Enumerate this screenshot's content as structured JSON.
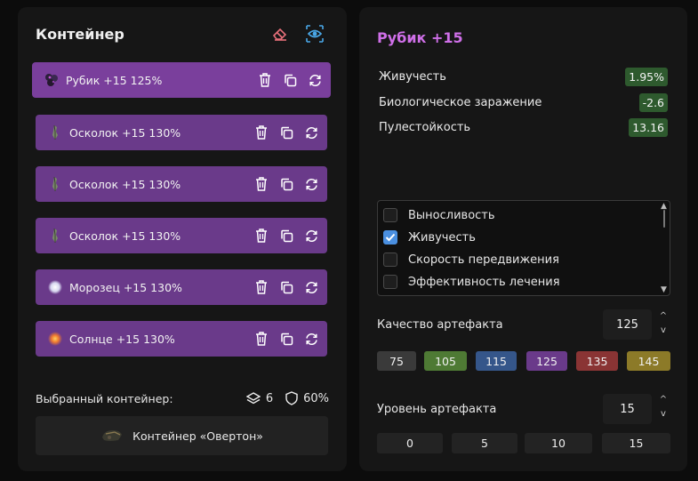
{
  "left": {
    "title": "Контейнер",
    "items": [
      {
        "name": "Рубик +15 125%"
      },
      {
        "name": "Осколок +15 130%"
      },
      {
        "name": "Осколок +15 130%"
      },
      {
        "name": "Осколок +15 130%"
      },
      {
        "name": "Морозец +15 130%"
      },
      {
        "name": "Солнце +15 130%"
      }
    ],
    "selected_label": "Выбранный контейнер:",
    "slots_count": "6",
    "protection": "60%",
    "container_name": "Контейнер «Овертон»"
  },
  "right": {
    "title": "Рубик +15",
    "stats": [
      {
        "label": "Живучесть",
        "value": "1.95%"
      },
      {
        "label": "Биологическое заражение",
        "value": "-2.6"
      },
      {
        "label": "Пулестойкость",
        "value": "13.16"
      }
    ],
    "checks": [
      {
        "label": "Выносливость",
        "checked": false
      },
      {
        "label": "Живучесть",
        "checked": true
      },
      {
        "label": "Скорость передвижения",
        "checked": false
      },
      {
        "label": "Эффективность лечения",
        "checked": false
      }
    ],
    "quality_label": "Качество артефакта",
    "quality_value": "125",
    "quality_chips": [
      {
        "label": "75",
        "color": "#3a3a3a"
      },
      {
        "label": "105",
        "color": "#4e7a34"
      },
      {
        "label": "115",
        "color": "#35568a"
      },
      {
        "label": "125",
        "color": "#6a3a8a"
      },
      {
        "label": "135",
        "color": "#8a3434"
      },
      {
        "label": "145",
        "color": "#8c7a28"
      }
    ],
    "level_label": "Уровень артефакта",
    "level_value": "15",
    "level_chips": [
      "0",
      "5",
      "10",
      "15"
    ]
  },
  "colors": {
    "item_bg": "#6a3a8a",
    "accent_title": "#cf6fe8",
    "stat_bg": "#2e5a2e",
    "check_on": "#4a8fe0"
  }
}
